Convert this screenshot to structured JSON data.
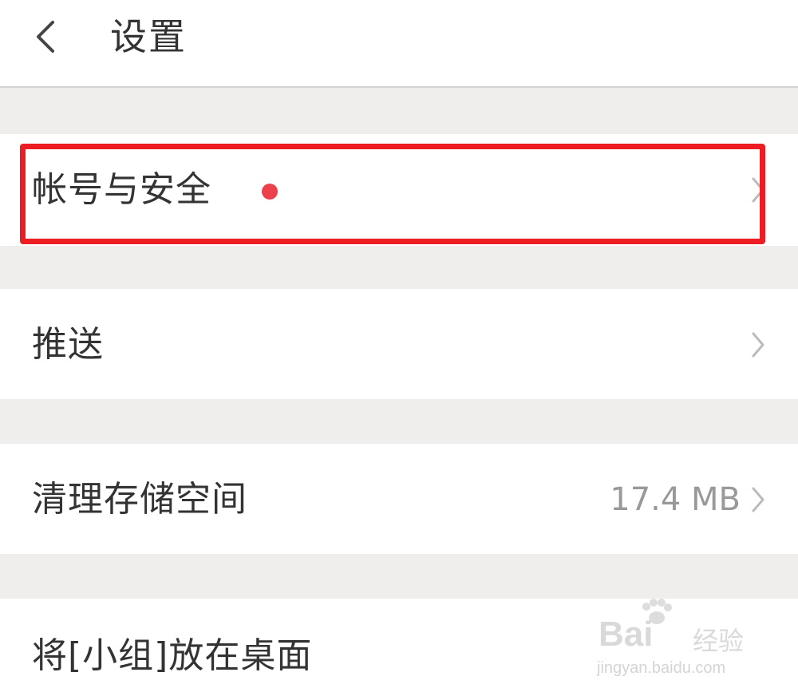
{
  "header": {
    "title": "设置"
  },
  "settings_items": [
    {
      "label": "帐号与安全",
      "has_badge": true,
      "badge_color": "#ee3f4d"
    },
    {
      "label": "推送"
    },
    {
      "label": "清理存储空间",
      "value": "17.4 MB"
    },
    {
      "label": "将[小组]放在桌面"
    }
  ],
  "colors": {
    "background": "#efeeec",
    "row_background": "#ffffff",
    "text_primary": "#333333",
    "text_secondary": "#999999",
    "highlight_border": "#ee1c23"
  },
  "icons": {
    "back": "chevron-left-icon",
    "row_arrow": "chevron-right-icon"
  },
  "watermark": {
    "brand": "Bai",
    "brand_cn": "经验",
    "url": "jingyan.baidu.com"
  }
}
